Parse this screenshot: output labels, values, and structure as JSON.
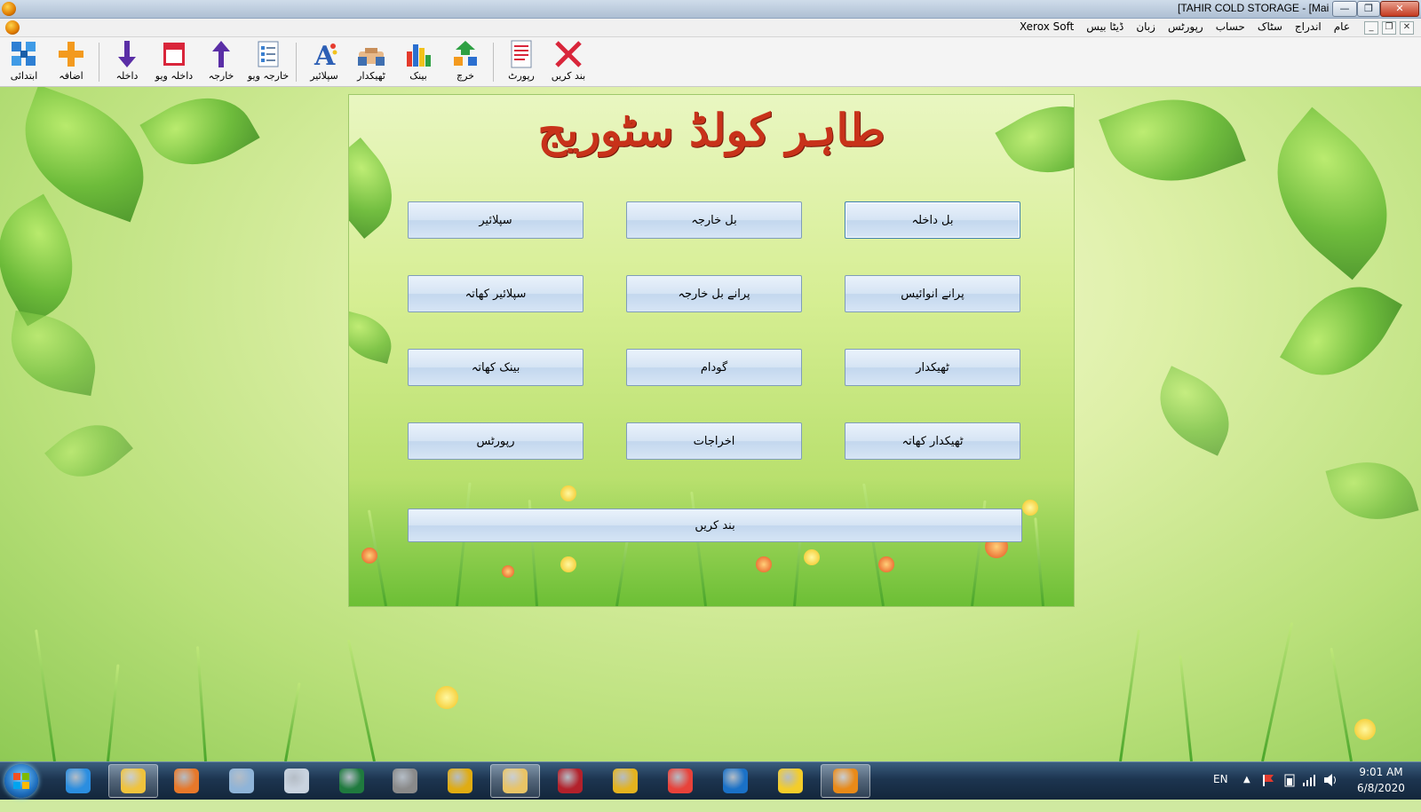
{
  "window": {
    "title": "[TAHIR COLD STORAGE - [Main",
    "minimize_glyph": "—",
    "maximize_glyph": "❐",
    "close_glyph": "✕"
  },
  "menubar": {
    "items": [
      "عام",
      "اندراج",
      "سٹاک",
      "حساب",
      "رپورٹس",
      "زبان",
      "ڈیٹا بیس",
      "Xerox Soft"
    ],
    "mdi_min": "_",
    "mdi_restore": "❐",
    "mdi_close": "✕"
  },
  "toolbar": {
    "items": [
      {
        "label": "ابتدائی",
        "icon": "dashboard-grid-icon"
      },
      {
        "label": "اضافہ",
        "icon": "plus-icon"
      },
      {
        "label": "داخلہ",
        "icon": "arrow-down-icon"
      },
      {
        "label": "داخلہ ویو",
        "icon": "book-icon"
      },
      {
        "label": "خارجہ",
        "icon": "arrow-up-icon"
      },
      {
        "label": "خارجہ ویو",
        "icon": "checklist-icon"
      },
      {
        "label": "سپلائیر",
        "icon": "font-a-icon"
      },
      {
        "label": "ٹھیکدار",
        "icon": "handshake-icon"
      },
      {
        "label": "بینک",
        "icon": "bank-chart-icon"
      },
      {
        "label": "خرچ",
        "icon": "recycle-icon"
      },
      {
        "label": "رپورٹ",
        "icon": "report-icon"
      },
      {
        "label": "بند کریں",
        "icon": "close-x-icon"
      }
    ]
  },
  "panel": {
    "title": "طاہر کولڈ سٹوریج",
    "buttons": [
      {
        "label": "بل داخلہ"
      },
      {
        "label": "بل خارجہ"
      },
      {
        "label": "سپلائیر"
      },
      {
        "label": "پرانے انوائیس"
      },
      {
        "label": "پرانے بل خارجہ"
      },
      {
        "label": "سپلائیر کھاتہ"
      },
      {
        "label": "ٹھیکدار"
      },
      {
        "label": "گودام"
      },
      {
        "label": "بینک کھاتہ"
      },
      {
        "label": "ٹھیکدار کھاتہ"
      },
      {
        "label": "اخراجات"
      },
      {
        "label": "رپورٹس"
      }
    ],
    "close_button": "بند کریں"
  },
  "taskbar": {
    "apps": [
      {
        "icon": "internet-explorer-icon",
        "color": "#2b8ee0"
      },
      {
        "icon": "folder-user-icon",
        "color": "#f0c33c"
      },
      {
        "icon": "media-player-icon",
        "color": "#e7782a"
      },
      {
        "icon": "paint-icon",
        "color": "#8fb4d8"
      },
      {
        "icon": "calculator-icon",
        "color": "#c9d3df"
      },
      {
        "icon": "excel-icon",
        "color": "#1f7a3e"
      },
      {
        "icon": "tools-icon",
        "color": "#8a8a8a"
      },
      {
        "icon": "target-icon",
        "color": "#e0ac12"
      },
      {
        "icon": "file-explorer-icon",
        "color": "#e9c466"
      },
      {
        "icon": "acrobat-icon",
        "color": "#b3212b"
      },
      {
        "icon": "chrome-icon",
        "color": "#e4b31f"
      },
      {
        "icon": "anydesk-icon",
        "color": "#e8423a"
      },
      {
        "icon": "teamviewer-icon",
        "color": "#1a71c7"
      },
      {
        "icon": "star-app-icon",
        "color": "#f4cd2a"
      },
      {
        "icon": "cold-storage-app-icon",
        "color": "#e98a18"
      }
    ],
    "language": "EN",
    "time": "9:01 AM",
    "date": "6/8/2020"
  }
}
